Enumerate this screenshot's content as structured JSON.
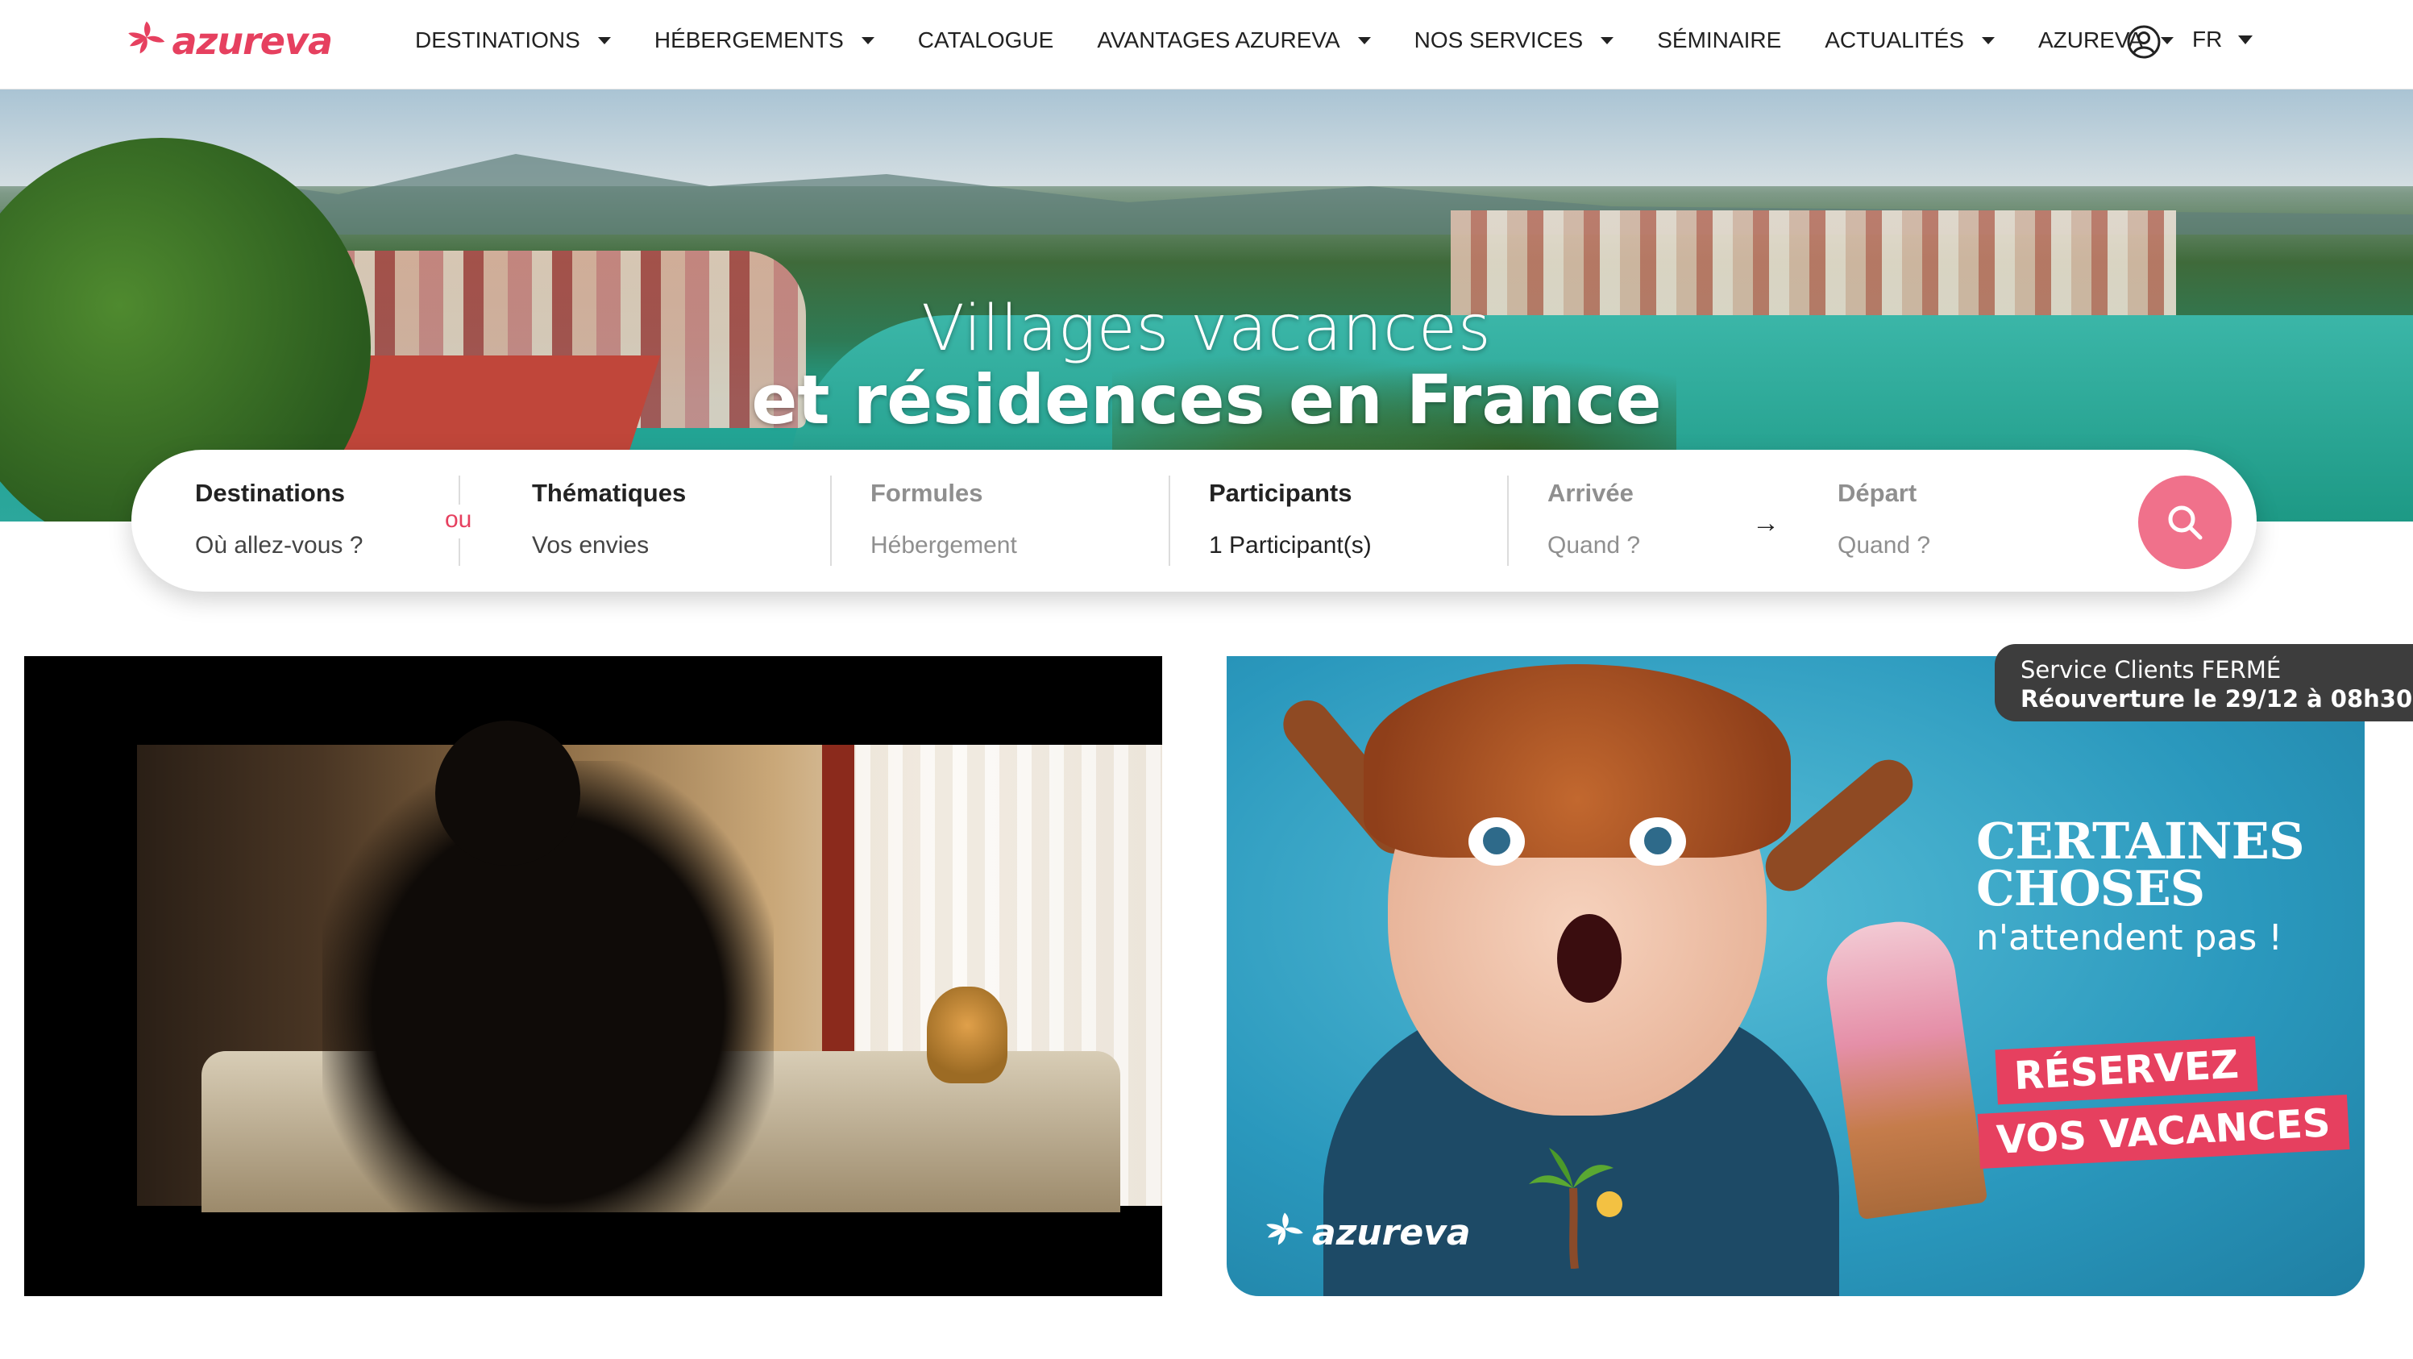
{
  "brand": {
    "name": "azureva",
    "accent": "#e6405f",
    "button_color": "#f0718b"
  },
  "nav": {
    "items": [
      {
        "label": "DESTINATIONS",
        "dropdown": true
      },
      {
        "label": "HÉBERGEMENTS",
        "dropdown": true
      },
      {
        "label": "CATALOGUE",
        "dropdown": false
      },
      {
        "label": "AVANTAGES AZUREVA",
        "dropdown": true
      },
      {
        "label": "NOS SERVICES",
        "dropdown": true
      },
      {
        "label": "SÉMINAIRE",
        "dropdown": false
      },
      {
        "label": "ACTUALITÉS",
        "dropdown": true
      },
      {
        "label": "AZUREVA",
        "dropdown": true
      }
    ],
    "account_icon": "user-circle-icon",
    "language": "FR"
  },
  "hero": {
    "title_line1": "Villages vacances",
    "title_line2": "et résidences en France"
  },
  "search": {
    "destinations": {
      "label": "Destinations",
      "placeholder": "Où allez-vous ?"
    },
    "or_label": "ou",
    "themes": {
      "label": "Thématiques",
      "placeholder": "Vos envies"
    },
    "formulas": {
      "label": "Formules",
      "placeholder": "Hébergement"
    },
    "participants": {
      "label": "Participants",
      "value": "1 Participant(s)"
    },
    "arrival": {
      "label": "Arrivée",
      "placeholder": "Quand ?"
    },
    "arrow_icon": "arrow-right-icon",
    "departure": {
      "label": "Départ",
      "placeholder": "Quand ?"
    },
    "button_icon": "search-icon"
  },
  "promo": {
    "headline_line1": "CERTAINES",
    "headline_line2": "CHOSES",
    "headline_line3": "n'attendent pas !",
    "cta_line1": "RÉSERVEZ",
    "cta_line2": "VOS VACANCES",
    "logo_text": "azureva"
  },
  "service_notice": {
    "line1": "Service Clients FERMÉ",
    "line2": "Réouverture le 29/12 à 08h30"
  }
}
